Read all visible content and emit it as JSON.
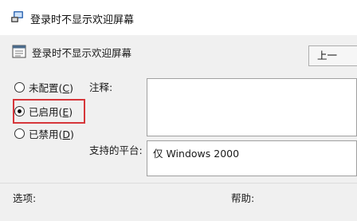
{
  "window": {
    "title": "登录时不显示欢迎屏幕",
    "icon": "policy-settings-icon"
  },
  "header": {
    "title": "登录时不显示欢迎屏幕",
    "icon": "policy-document-icon",
    "previous_button_label": "上一"
  },
  "state": {
    "options": [
      {
        "label": "未配置(",
        "access_key": "C",
        "suffix": ")",
        "checked": false
      },
      {
        "label": "已启用(",
        "access_key": "E",
        "suffix": ")",
        "checked": true
      },
      {
        "label": "已禁用(",
        "access_key": "D",
        "suffix": ")",
        "checked": false
      }
    ],
    "highlight_color": "#d6363a"
  },
  "comment": {
    "label": "注释:",
    "value": ""
  },
  "supported_on": {
    "label": "支持的平台:",
    "value": "仅 Windows 2000"
  },
  "bottom": {
    "options_label": "选项:",
    "help_label": "帮助:"
  }
}
